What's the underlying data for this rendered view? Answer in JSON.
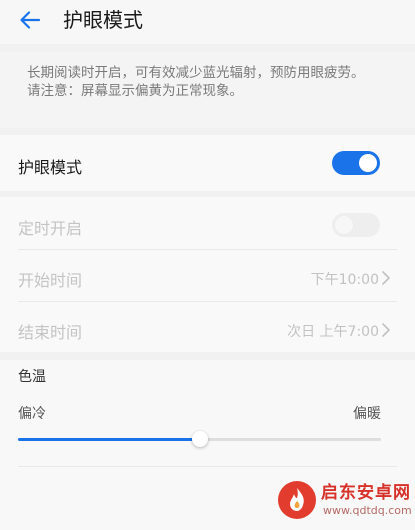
{
  "header": {
    "title": "护眼模式",
    "back_icon": "arrow-left-icon"
  },
  "description": {
    "text": "长期阅读时开启，可有效减少蓝光辐射，预防用眼疲劳。\n请注意：屏幕显示偏黄为正常现象。"
  },
  "eye_mode": {
    "label": "护眼模式",
    "enabled": true
  },
  "schedule": {
    "label": "定时开启",
    "enabled": false
  },
  "start_time": {
    "label": "开始时间",
    "value": "下午10:00"
  },
  "end_time": {
    "label": "结束时间",
    "value": "次日 上午7:00"
  },
  "color_temperature": {
    "section_label": "色温",
    "cool_label": "偏冷",
    "warm_label": "偏暖",
    "value": 0.5
  },
  "watermark": {
    "name": "启东安卓网",
    "url": "www.qdtdq.com"
  },
  "colors": {
    "accent": "#1a73e8",
    "disabled_text": "#c4c4c4",
    "background": "#f1f1f1"
  }
}
